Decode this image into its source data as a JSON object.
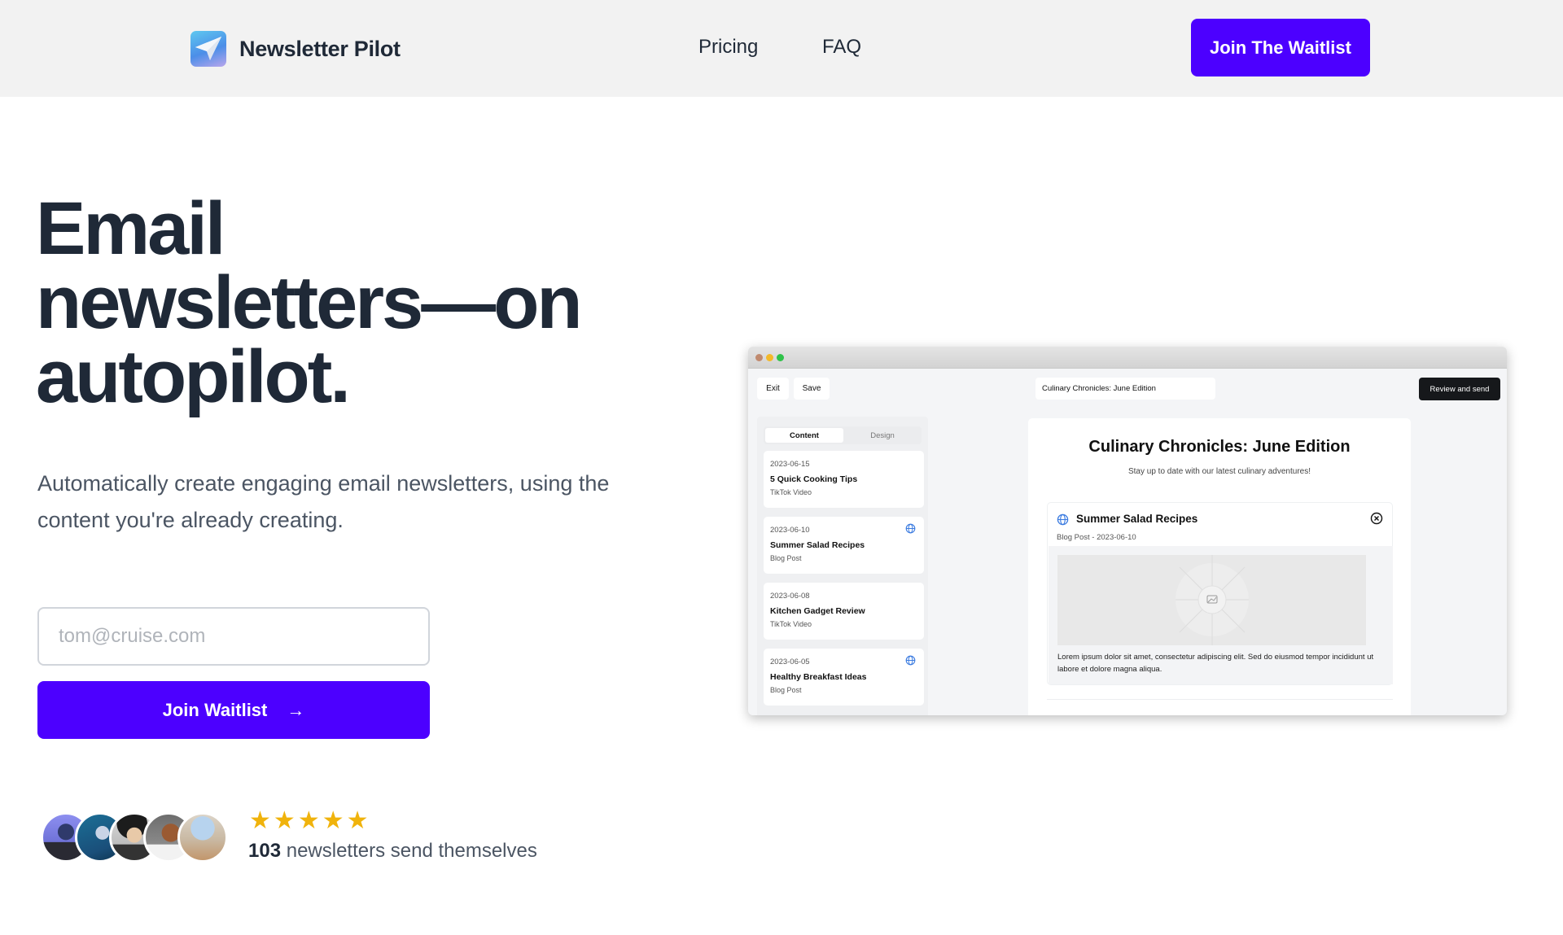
{
  "header": {
    "brand": "Newsletter Pilot",
    "brand_icon": "paper-plane-icon",
    "nav": [
      {
        "label": "Pricing"
      },
      {
        "label": "FAQ"
      }
    ],
    "cta_label": "Join The Waitlist",
    "accent_color": "#4c00ff"
  },
  "hero": {
    "headline_lines": [
      "Email",
      "newsletters—on",
      "autopilot."
    ],
    "subtext": "Automatically create engaging email newsletters, using the content you're already creating.",
    "email_placeholder": "tom@cruise.com",
    "email_value": "",
    "join_label": "Join Waitlist",
    "join_icon": "arrow-right-icon",
    "arrow_glyph": "→"
  },
  "social_proof": {
    "avatars_count": 5,
    "rating_stars": 5,
    "star_glyph": "★",
    "count": "103",
    "count_suffix": " newsletters send themselves"
  },
  "app_preview": {
    "toolbar": {
      "exit_label": "Exit",
      "save_label": "Save",
      "title_value": "Culinary Chronicles: June Edition",
      "review_label": "Review and send"
    },
    "sidebar": {
      "tabs": [
        {
          "label": "Content",
          "active": true
        },
        {
          "label": "Design",
          "active": false
        }
      ],
      "items": [
        {
          "date": "2023-06-15",
          "title": "5 Quick Cooking Tips",
          "type": "TikTok Video",
          "web": false
        },
        {
          "date": "2023-06-10",
          "title": "Summer Salad Recipes",
          "type": "Blog Post",
          "web": true
        },
        {
          "date": "2023-06-08",
          "title": "Kitchen Gadget Review",
          "type": "TikTok Video",
          "web": false
        },
        {
          "date": "2023-06-05",
          "title": "Healthy Breakfast Ideas",
          "type": "Blog Post",
          "web": true
        }
      ]
    },
    "canvas": {
      "title": "Culinary Chronicles: June Edition",
      "subtitle": "Stay up to date with our latest culinary adventures!",
      "card": {
        "title": "Summer Salad Recipes",
        "meta": "Blog Post - 2023-06-10",
        "body": "Lorem ipsum dolor sit amet, consectetur adipiscing elit. Sed do eiusmod tempor incididunt ut labore et dolore magna aliqua."
      }
    }
  }
}
